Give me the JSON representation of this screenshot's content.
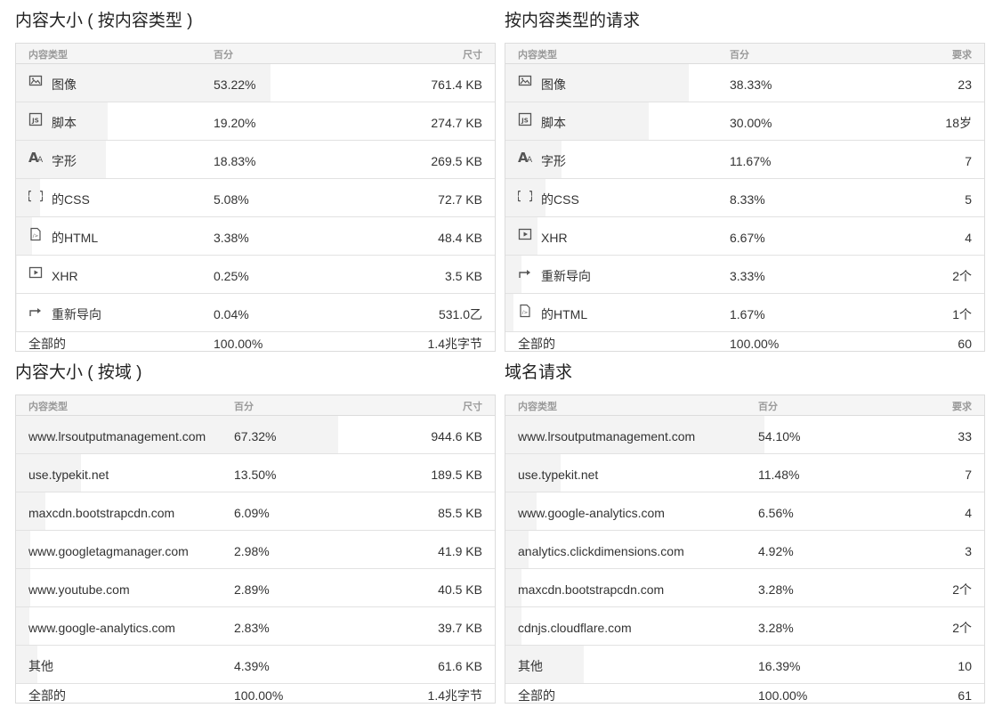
{
  "colors": {
    "bar": "#f3f3f3",
    "border": "#dcdcdc",
    "header_bg": "#f5f5f5",
    "header_text": "#9a9a9a"
  },
  "panels": {
    "size_by_type": {
      "title": "内容大小 ( 按内容类型 )",
      "headers": {
        "type": "内容类型",
        "percent": "百分",
        "value": "尺寸"
      },
      "rows": [
        {
          "icon": "image-icon",
          "label": "图像",
          "percent": "53.22%",
          "share": 53.22,
          "value": "761.4 KB"
        },
        {
          "icon": "script-icon",
          "label": "脚本",
          "percent": "19.20%",
          "share": 19.2,
          "value": "274.7 KB"
        },
        {
          "icon": "font-icon",
          "label": "字形",
          "percent": "18.83%",
          "share": 18.83,
          "value": "269.5 KB"
        },
        {
          "icon": "css-icon",
          "label": "的CSS",
          "percent": "5.08%",
          "share": 5.08,
          "value": "72.7 KB"
        },
        {
          "icon": "html-icon",
          "label": "的HTML",
          "percent": "3.38%",
          "share": 3.38,
          "value": "48.4 KB"
        },
        {
          "icon": "xhr-icon",
          "label": "XHR",
          "percent": "0.25%",
          "share": 0.25,
          "value": "3.5 KB"
        },
        {
          "icon": "redirect-icon",
          "label": "重新导向",
          "percent": "0.04%",
          "share": 0.04,
          "value": "531.0乙"
        }
      ],
      "total": {
        "label": "全部的",
        "percent": "100.00%",
        "value": "1.4兆字节"
      }
    },
    "requests_by_type": {
      "title": "按内容类型的请求",
      "headers": {
        "type": "内容类型",
        "percent": "百分",
        "value": "要求"
      },
      "rows": [
        {
          "icon": "image-icon",
          "label": "图像",
          "percent": "38.33%",
          "share": 38.33,
          "value": "23"
        },
        {
          "icon": "script-icon",
          "label": "脚本",
          "percent": "30.00%",
          "share": 30.0,
          "value": "18岁"
        },
        {
          "icon": "font-icon",
          "label": "字形",
          "percent": "11.67%",
          "share": 11.67,
          "value": "7"
        },
        {
          "icon": "css-icon",
          "label": "的CSS",
          "percent": "8.33%",
          "share": 8.33,
          "value": "5"
        },
        {
          "icon": "xhr-icon",
          "label": "XHR",
          "percent": "6.67%",
          "share": 6.67,
          "value": "4"
        },
        {
          "icon": "redirect-icon",
          "label": "重新导向",
          "percent": "3.33%",
          "share": 3.33,
          "value": "2个"
        },
        {
          "icon": "html-icon",
          "label": "的HTML",
          "percent": "1.67%",
          "share": 1.67,
          "value": "1个"
        }
      ],
      "total": {
        "label": "全部的",
        "percent": "100.00%",
        "value": "60"
      }
    },
    "size_by_domain": {
      "title": "内容大小 ( 按域 )",
      "headers": {
        "type": "内容类型",
        "percent": "百分",
        "value": "尺寸"
      },
      "rows": [
        {
          "label": "www.lrsoutputmanagement.com",
          "percent": "67.32%",
          "share": 67.32,
          "value": "944.6 KB"
        },
        {
          "label": "use.typekit.net",
          "percent": "13.50%",
          "share": 13.5,
          "value": "189.5 KB"
        },
        {
          "label": "maxcdn.bootstrapcdn.com",
          "percent": "6.09%",
          "share": 6.09,
          "value": "85.5 KB"
        },
        {
          "label": "www.googletagmanager.com",
          "percent": "2.98%",
          "share": 2.98,
          "value": "41.9 KB"
        },
        {
          "label": "www.youtube.com",
          "percent": "2.89%",
          "share": 2.89,
          "value": "40.5 KB"
        },
        {
          "label": "www.google-analytics.com",
          "percent": "2.83%",
          "share": 2.83,
          "value": "39.7 KB"
        },
        {
          "label": "其他",
          "percent": "4.39%",
          "share": 4.39,
          "value": "61.6 KB"
        }
      ],
      "total": {
        "label": "全部的",
        "percent": "100.00%",
        "value": "1.4兆字节"
      }
    },
    "requests_by_domain": {
      "title": "域名请求",
      "headers": {
        "type": "内容类型",
        "percent": "百分",
        "value": "要求"
      },
      "rows": [
        {
          "label": "www.lrsoutputmanagement.com",
          "percent": "54.10%",
          "share": 54.1,
          "value": "33"
        },
        {
          "label": "use.typekit.net",
          "percent": "11.48%",
          "share": 11.48,
          "value": "7"
        },
        {
          "label": "www.google-analytics.com",
          "percent": "6.56%",
          "share": 6.56,
          "value": "4"
        },
        {
          "label": "analytics.clickdimensions.com",
          "percent": "4.92%",
          "share": 4.92,
          "value": "3"
        },
        {
          "label": "maxcdn.bootstrapcdn.com",
          "percent": "3.28%",
          "share": 3.28,
          "value": "2个"
        },
        {
          "label": "cdnjs.cloudflare.com",
          "percent": "3.28%",
          "share": 3.28,
          "value": "2个"
        },
        {
          "label": "其他",
          "percent": "16.39%",
          "share": 16.39,
          "value": "10"
        }
      ],
      "total": {
        "label": "全部的",
        "percent": "100.00%",
        "value": "61"
      }
    }
  }
}
